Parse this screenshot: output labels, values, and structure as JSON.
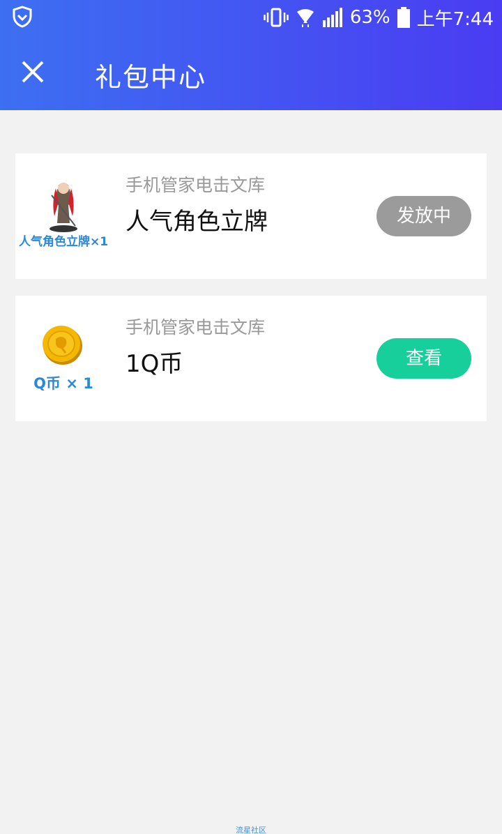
{
  "status_bar": {
    "battery": "63%",
    "time": "上午7:44",
    "icons": [
      "shield-icon",
      "vibrate-icon",
      "wifi-icon",
      "signal-icon",
      "battery-icon"
    ]
  },
  "header": {
    "title": "礼包中心",
    "close_icon": "close-icon"
  },
  "gifts": [
    {
      "thumb_caption": "人气角色立牌×1",
      "source": "手机管家电击文库",
      "name": "人气角色立牌",
      "action": "发放中"
    },
    {
      "thumb_caption": "Q币 × 1",
      "source": "手机管家电击文库",
      "name": "1Q币",
      "action": "查看"
    }
  ],
  "watermark": "流星社区",
  "colors": {
    "header_start": "#3d6ff2",
    "header_end": "#4a3cf2",
    "button_gray": "#9b9b9b",
    "button_green": "#16cf9a",
    "caption_blue": "#2a88d8"
  }
}
